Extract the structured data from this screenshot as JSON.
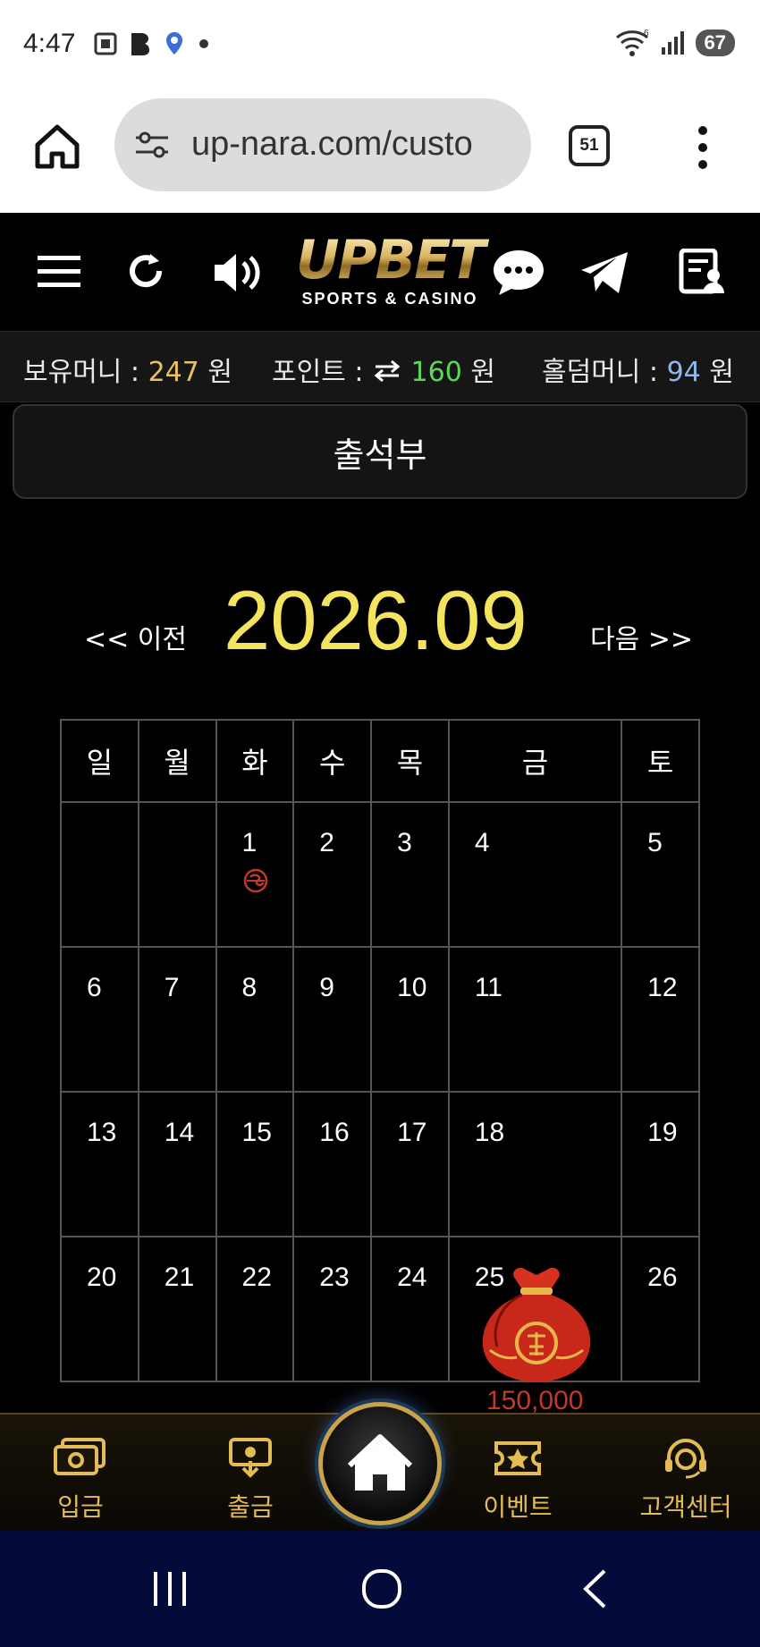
{
  "status_bar": {
    "time": "4:47",
    "battery": "67",
    "signal_label": "6"
  },
  "browser": {
    "url": "up-nara.com/custo",
    "tab_count": "51"
  },
  "header": {
    "logo_main": "UPBET",
    "logo_sub": "SPORTS & CASINO"
  },
  "balance": {
    "money_label": "보유머니 :",
    "money_value": "247",
    "points_label": "포인트 :",
    "points_value": "160",
    "holdem_label": "홀덤머니 :",
    "holdem_value": "94",
    "unit": "원"
  },
  "page_title": "출석부",
  "calendar": {
    "prev_label": "<< 이전",
    "next_label": "다음 >>",
    "month": "2026.09",
    "weekdays": [
      "일",
      "월",
      "화",
      "수",
      "목",
      "금",
      "토"
    ],
    "weeks": [
      [
        "",
        "",
        "1",
        "2",
        "3",
        "4",
        "5"
      ],
      [
        "6",
        "7",
        "8",
        "9",
        "10",
        "11",
        "12"
      ],
      [
        "13",
        "14",
        "15",
        "16",
        "17",
        "18",
        "19"
      ],
      [
        "20",
        "21",
        "22",
        "23",
        "24",
        "25",
        "26"
      ]
    ],
    "prize_amount": "150,000"
  },
  "bottom_nav": {
    "deposit": "입금",
    "withdraw": "출금",
    "event": "이벤트",
    "support": "고객센터"
  },
  "colors": {
    "gold": "#e8c35f",
    "green": "#5bd85b",
    "blue": "#8fb8e8",
    "month": "#f3e35f"
  }
}
